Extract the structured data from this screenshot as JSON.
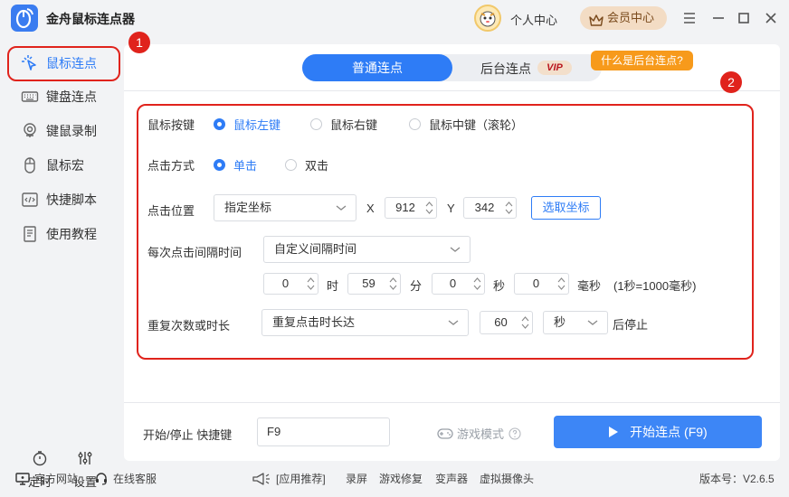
{
  "app": {
    "title": "金舟鼠标连点器"
  },
  "header": {
    "user_center": "个人中心",
    "vip_center": "会员中心"
  },
  "sidebar": {
    "items": [
      {
        "label": "鼠标连点",
        "icon": "cursor-click-icon",
        "active": true
      },
      {
        "label": "键盘连点",
        "icon": "keyboard-icon"
      },
      {
        "label": "键鼠录制",
        "icon": "record-icon"
      },
      {
        "label": "鼠标宏",
        "icon": "mouse-icon"
      },
      {
        "label": "快捷脚本",
        "icon": "script-icon"
      },
      {
        "label": "使用教程",
        "icon": "tutorial-icon"
      }
    ],
    "bottom": [
      {
        "label": "定时",
        "icon": "timer-icon"
      },
      {
        "label": "设置",
        "icon": "settings-icon"
      }
    ]
  },
  "annotations": {
    "badge1": "1",
    "badge2": "2"
  },
  "tabs": {
    "normal": "普通连点",
    "background": "后台连点",
    "vip": "VIP",
    "what_is": "什么是后台连点?"
  },
  "form": {
    "mouse_button": {
      "label": "鼠标按键",
      "options": [
        "鼠标左键",
        "鼠标右键",
        "鼠标中键（滚轮）"
      ],
      "selected": 0
    },
    "click_mode": {
      "label": "点击方式",
      "options": [
        "单击",
        "双击"
      ],
      "selected": 0
    },
    "click_position": {
      "label": "点击位置",
      "mode": "指定坐标",
      "x_label": "X",
      "x": "912",
      "y_label": "Y",
      "y": "342",
      "pick_button": "选取坐标"
    },
    "interval": {
      "label": "每次点击间隔时间",
      "mode": "自定义间隔时间",
      "hours": "0",
      "hours_unit": "时",
      "minutes": "59",
      "minutes_unit": "分",
      "seconds": "0",
      "seconds_unit": "秒",
      "ms": "0",
      "ms_unit": "毫秒",
      "hint": "(1秒=1000毫秒)"
    },
    "repeat": {
      "label": "重复次数或时长",
      "mode": "重复点击时长达",
      "value": "60",
      "unit": "秒",
      "suffix": "后停止"
    }
  },
  "bottom_bar": {
    "hotkey_label": "开始/停止 快捷键",
    "hotkey_value": "F9",
    "game_mode": "游戏模式",
    "start_button": "开始连点 (F9)"
  },
  "footer": {
    "website": "官方网站",
    "service": "在线客服",
    "recommend": "[应用推荐]",
    "links": [
      "录屏",
      "游戏修复",
      "变声器",
      "虚拟摄像头"
    ],
    "version": "版本号：V2.6.5"
  },
  "colors": {
    "accent": "#2e7cf6",
    "annotation": "#e0231c",
    "vip_orange": "#f79a1b"
  }
}
